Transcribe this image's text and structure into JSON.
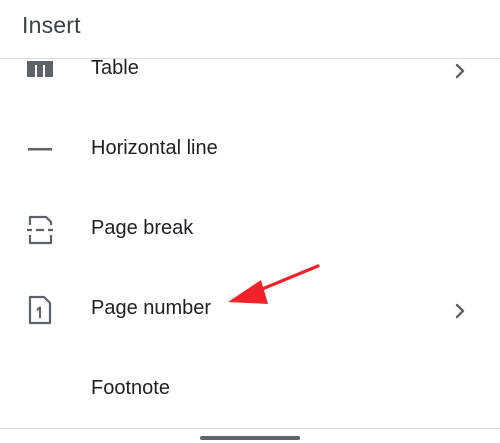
{
  "header": {
    "title": "Insert"
  },
  "menu": {
    "items": [
      {
        "label": "Table",
        "icon": "table-icon",
        "has_submenu": true
      },
      {
        "label": "Horizontal line",
        "icon": "horizontal-line-icon",
        "has_submenu": false
      },
      {
        "label": "Page break",
        "icon": "page-break-icon",
        "has_submenu": false
      },
      {
        "label": "Page number",
        "icon": "page-number-icon",
        "has_submenu": true
      },
      {
        "label": "Footnote",
        "icon": "",
        "has_submenu": false
      }
    ]
  },
  "annotation": {
    "type": "arrow",
    "color": "#f0232b",
    "points_to": "Page number"
  },
  "colors": {
    "icon": "#5f6368",
    "text": "#202124",
    "divider": "#dadce0"
  }
}
